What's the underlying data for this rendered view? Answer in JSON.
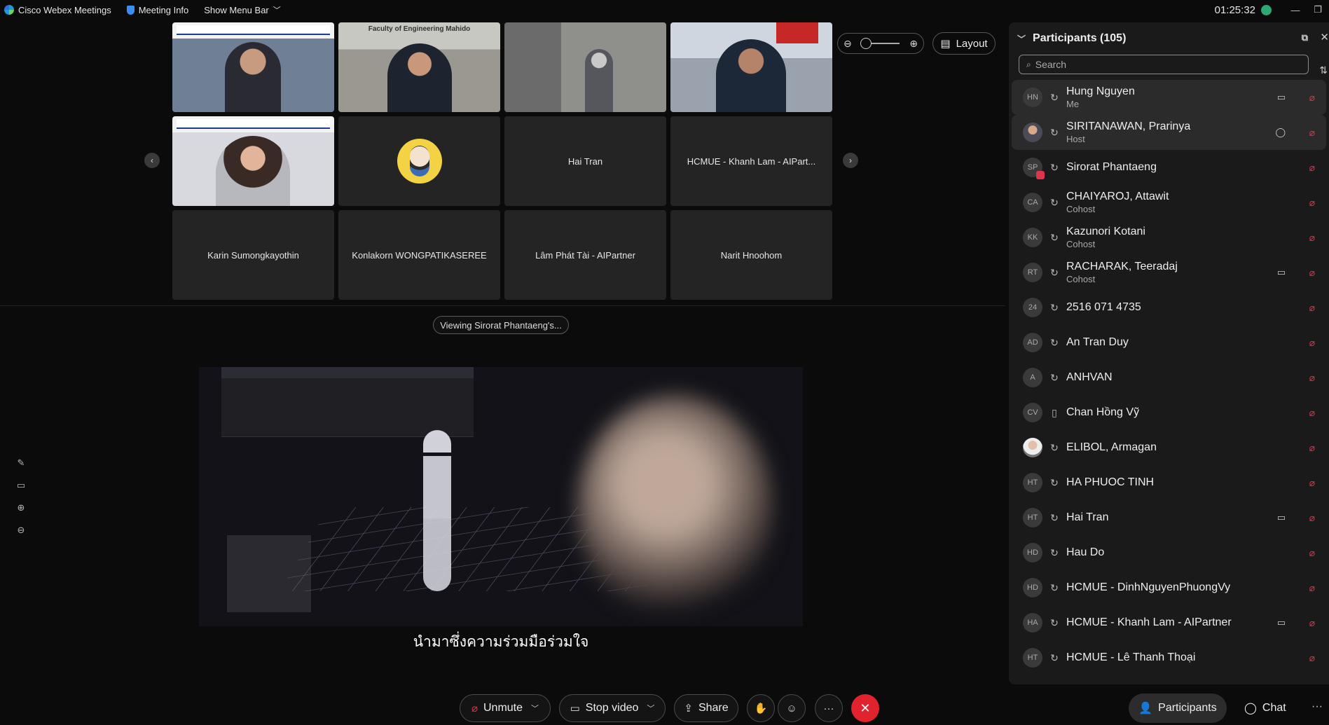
{
  "titlebar": {
    "app_name": "Cisco Webex Meetings",
    "meeting_info": "Meeting Info",
    "show_menu_bar": "Show Menu Bar",
    "clock": "01:25:32",
    "minimize": "—",
    "restore": "❐"
  },
  "grid": {
    "tiles": [
      {
        "kind": "slide",
        "label": ""
      },
      {
        "kind": "office",
        "label": "",
        "banner": "Faculty of Engineering Mahido"
      },
      {
        "kind": "room",
        "label": ""
      },
      {
        "kind": "cam",
        "label": ""
      },
      {
        "kind": "woman",
        "label": ""
      },
      {
        "kind": "avatar",
        "label": ""
      },
      {
        "kind": "name",
        "label": "Hai Tran"
      },
      {
        "kind": "name",
        "label": "HCMUE - Khanh Lam - AIPart..."
      },
      {
        "kind": "name",
        "label": "Karin Sumongkayothin"
      },
      {
        "kind": "name",
        "label": "Konlakorn WONGPATIKASEREE"
      },
      {
        "kind": "name",
        "label": "Lâm Phát Tài - AIPartner"
      },
      {
        "kind": "name",
        "label": "Narit Hnoohom"
      }
    ]
  },
  "controls": {
    "layout_label": "Layout",
    "viewing_label": "Viewing Sirorat Phantaeng's..."
  },
  "share": {
    "subtitle": "นำมาซึ่งความร่วมมือร่วมใจ"
  },
  "participants_panel": {
    "title": "Participants (105)",
    "search_placeholder": "Search",
    "items": [
      {
        "initials": "HN",
        "name": "Hung Nguyen",
        "role": "Me",
        "camera": true,
        "highlight": true
      },
      {
        "initials": "",
        "photo": true,
        "name": "SIRITANAWAN, Prarinya",
        "role": "Host",
        "chat": true,
        "highlight": true
      },
      {
        "initials": "SP",
        "badge": true,
        "name": "Sirorat Phantaeng",
        "role": ""
      },
      {
        "initials": "CA",
        "name": "CHAIYAROJ, Attawit",
        "role": "Cohost"
      },
      {
        "initials": "KK",
        "name": "Kazunori Kotani",
        "role": "Cohost"
      },
      {
        "initials": "RT",
        "name": "RACHARAK, Teeradaj",
        "role": "Cohost",
        "camera": true
      },
      {
        "initials": "24",
        "name": "2516 071 4735",
        "role": ""
      },
      {
        "initials": "AD",
        "name": "An Tran Duy",
        "role": ""
      },
      {
        "initials": "A",
        "name": "ANHVAN",
        "role": ""
      },
      {
        "initials": "CV",
        "name": "Chan Hồng Vỹ",
        "role": "",
        "phone": true
      },
      {
        "initials": "",
        "photo2": true,
        "name": "ELIBOL, Armagan",
        "role": ""
      },
      {
        "initials": "HT",
        "name": "HA PHUOC TINH",
        "role": ""
      },
      {
        "initials": "HT",
        "name": "Hai Tran",
        "role": "",
        "camera": true
      },
      {
        "initials": "HD",
        "name": "Hau Do",
        "role": ""
      },
      {
        "initials": "HD",
        "name": "HCMUE - DinhNguyenPhuongVy",
        "role": ""
      },
      {
        "initials": "HA",
        "name": "HCMUE - Khanh Lam - AIPartner",
        "role": "",
        "camera": true
      },
      {
        "initials": "HT",
        "name": "HCMUE - Lê Thanh Thoại",
        "role": ""
      }
    ]
  },
  "bottombar": {
    "unmute": "Unmute",
    "stop_video": "Stop video",
    "share": "Share",
    "participants": "Participants",
    "chat": "Chat"
  },
  "colors": {
    "end_call": "#e0232d",
    "mic_muted": "#e0344d",
    "panel_bg": "#1a1a1a"
  }
}
